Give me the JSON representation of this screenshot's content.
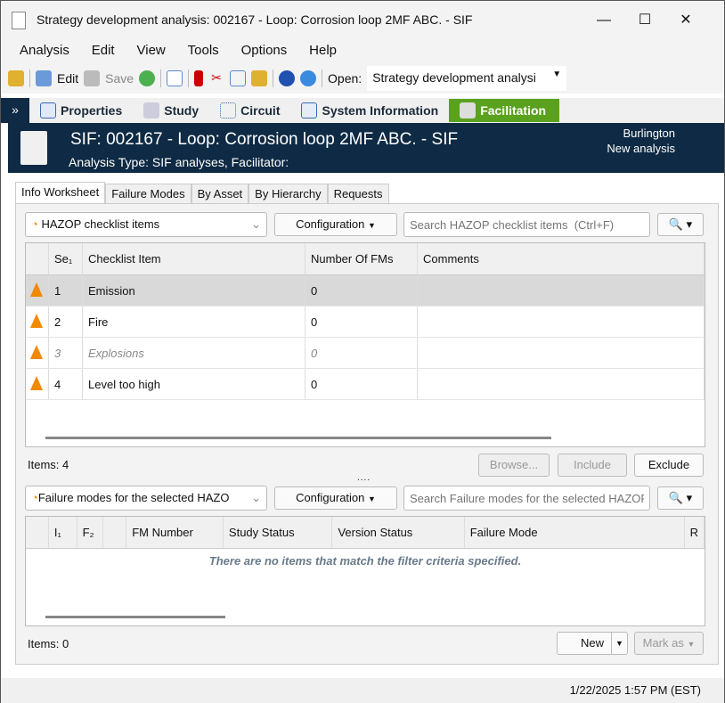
{
  "window": {
    "title": "Strategy development analysis: 002167 - Loop: Corrosion loop 2MF ABC. - SIF",
    "min": "—",
    "max": "☐",
    "close": "✕"
  },
  "menu": [
    "Analysis",
    "Edit",
    "View",
    "Tools",
    "Options",
    "Help"
  ],
  "toolbar": {
    "edit": "Edit",
    "save": "Save",
    "open_label": "Open:",
    "open_value": "Strategy development analysi"
  },
  "nav": [
    "Properties",
    "Study",
    "Circuit",
    "System Information",
    "Facilitation"
  ],
  "header": {
    "title": "SIF: 002167 - Loop: Corrosion loop 2MF ABC. - SIF",
    "subtitle": "Analysis Type: SIF analyses, Facilitator:",
    "site": "Burlington",
    "state": "New analysis"
  },
  "tabs": [
    "Info Worksheet",
    "Failure Modes",
    "By Asset",
    "By Hierarchy",
    "Requests"
  ],
  "top": {
    "filter": "HAZOP checklist items",
    "config": "Configuration",
    "search_placeholder": "Search HAZOP checklist items  (Ctrl+F)",
    "columns": [
      "Se₁",
      "Checklist Item",
      "Number Of FMs",
      "Comments"
    ],
    "rows": [
      {
        "seq": "1",
        "item": "Emission",
        "fms": "0"
      },
      {
        "seq": "2",
        "item": "Fire",
        "fms": "0"
      },
      {
        "seq": "3",
        "item": "Explosions",
        "fms": "0"
      },
      {
        "seq": "4",
        "item": "Level too high",
        "fms": "0"
      }
    ],
    "items": "Items: 4",
    "browse": "Browse...",
    "include": "Include",
    "exclude": "Exclude"
  },
  "bottom": {
    "filter": "Failure modes for the selected HAZO",
    "config": "Configuration",
    "search_placeholder": "Search Failure modes for the selected HAZOP",
    "columns": [
      "I₁",
      "F₂",
      "",
      "FM Number",
      "Study Status",
      "Version Status",
      "Failure Mode",
      "R"
    ],
    "empty": "There are no items that match the filter criteria specified.",
    "items": "Items: 0",
    "new": "New",
    "mark_as": "Mark as"
  },
  "status": {
    "datetime": "1/22/2025 1:57 PM (EST)"
  }
}
